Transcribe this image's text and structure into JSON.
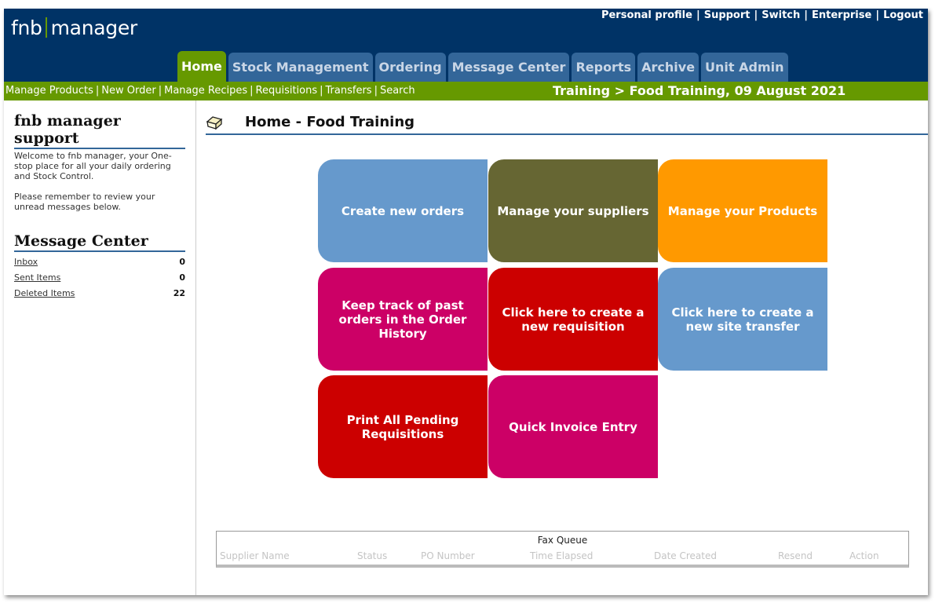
{
  "header": {
    "logo_left": "fnb",
    "logo_right": "manager",
    "top_links": [
      "Personal profile",
      "Support",
      "Switch",
      "Enterprise",
      "Logout"
    ],
    "tabs": [
      {
        "label": "Home",
        "active": true
      },
      {
        "label": "Stock Management",
        "active": false
      },
      {
        "label": "Ordering",
        "active": false
      },
      {
        "label": "Message Center",
        "active": false
      },
      {
        "label": "Reports",
        "active": false
      },
      {
        "label": "Archive",
        "active": false
      },
      {
        "label": "Unit Admin",
        "active": false
      }
    ]
  },
  "subnav": {
    "links": [
      "Manage Products",
      "New Order",
      "Manage Recipes",
      "Requisitions",
      "Transfers",
      "Search"
    ],
    "breadcrumb": "Training > Food Training,  09 August 2021"
  },
  "sidebar": {
    "support_title": "fnb manager support",
    "welcome_text": "Welcome to fnb manager, your One-stop place for all your daily ordering and Stock Control.",
    "reminder_text": "Please remember to review your unread messages below.",
    "message_center_title": "Message Center",
    "messages": [
      {
        "label": "Inbox",
        "count": "0"
      },
      {
        "label": "Sent Items",
        "count": "0"
      },
      {
        "label": "Deleted Items",
        "count": "22"
      }
    ]
  },
  "main": {
    "page_title": "Home - Food Training",
    "page_icon": "home-box-icon",
    "tiles": [
      {
        "label": "Create new orders",
        "color": "#6699cc"
      },
      {
        "label": "Manage your suppliers",
        "color": "#666633"
      },
      {
        "label": "Manage your Products",
        "color": "#ff9900"
      },
      {
        "label": "Keep track of past orders in the Order History",
        "color": "#cc0066"
      },
      {
        "label": "Click here to create a new requisition",
        "color": "#cc0000"
      },
      {
        "label": "Click here to create a new site transfer",
        "color": "#6699cc"
      },
      {
        "label": "Print All Pending Requisitions",
        "color": "#cc0000"
      },
      {
        "label": "Quick Invoice Entry",
        "color": "#cc0066"
      }
    ]
  },
  "fax_queue": {
    "title": "Fax Queue",
    "columns": [
      "Supplier Name",
      "Status",
      "PO Number",
      "Time Elapsed",
      "Date Created",
      "Resend",
      "Action"
    ]
  },
  "colors": {
    "header_bg": "#003366",
    "nav_green": "#669900",
    "tab_blue": "#336699",
    "title_rule": "#336699"
  }
}
